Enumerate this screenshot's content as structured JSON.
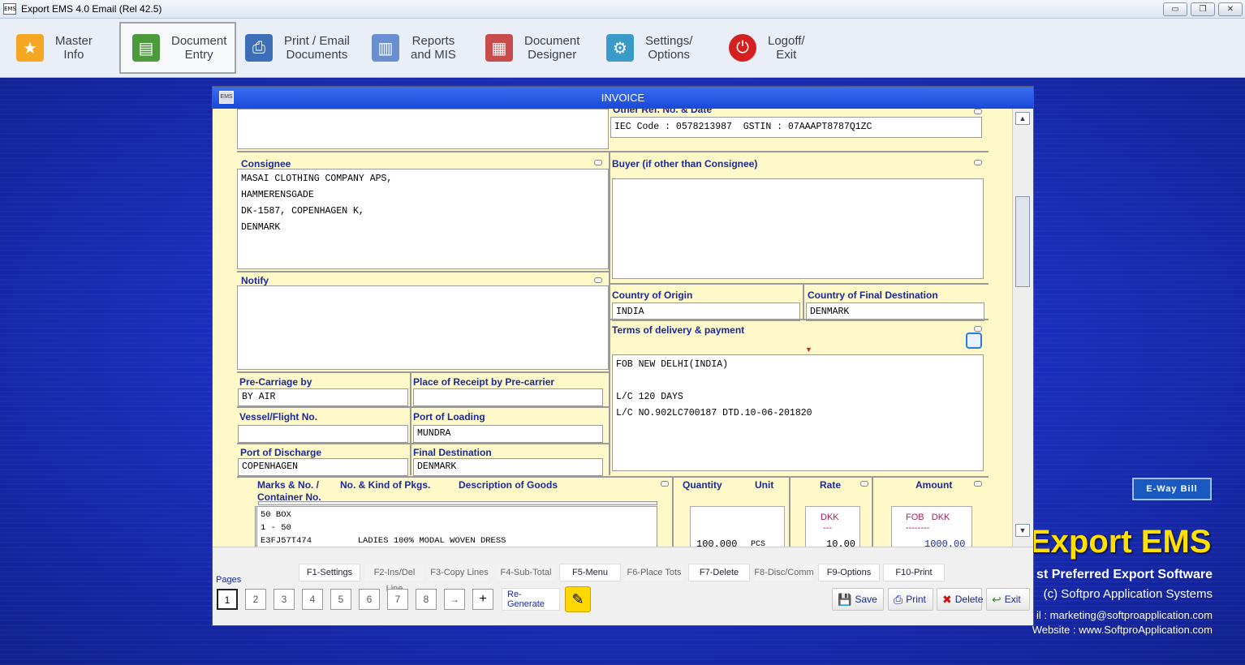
{
  "window": {
    "title": "Export EMS 4.0 Email (Rel 42.5)",
    "app_icon": "EMS"
  },
  "window_controls": {
    "minimize": "▭",
    "restore": "❐",
    "close": "✕"
  },
  "toolbar": [
    {
      "id": "master",
      "label1": "Master",
      "label2": "Info",
      "icon": "star-icon",
      "glyph": "★"
    },
    {
      "id": "document",
      "label1": "Document",
      "label2": "Entry",
      "icon": "document-entry-icon",
      "glyph": "▤"
    },
    {
      "id": "print",
      "label1": "Print / Email",
      "label2": "Documents",
      "icon": "printer-icon",
      "glyph": "⎙"
    },
    {
      "id": "reports",
      "label1": "Reports",
      "label2": "and MIS",
      "icon": "chart-icon",
      "glyph": "▥"
    },
    {
      "id": "designer",
      "label1": "Document",
      "label2": "Designer",
      "icon": "designer-icon",
      "glyph": "▦"
    },
    {
      "id": "settings",
      "label1": "Settings/",
      "label2": "Options",
      "icon": "gears-icon",
      "glyph": "⚙"
    },
    {
      "id": "logoff",
      "label1": "Logoff/",
      "label2": "Exit",
      "icon": "power-icon",
      "glyph": "⏻"
    }
  ],
  "dialog": {
    "title": "INVOICE",
    "icon": "EMS"
  },
  "form": {
    "other_ref": {
      "label": "Other Ref. No. & Date",
      "value": "IEC Code : 0578213987  GSTIN : 07AAAPT8787Q1ZC"
    },
    "consignee": {
      "label": "Consignee",
      "value": "MASAI CLOTHING COMPANY APS,\nHAMMERENSGADE\nDK-1587, COPENHAGEN K,\nDENMARK"
    },
    "buyer": {
      "label": "Buyer (if other than Consignee)",
      "value": ""
    },
    "notify": {
      "label": "Notify",
      "value": ""
    },
    "country_origin": {
      "label": "Country of Origin",
      "value": "INDIA"
    },
    "country_dest": {
      "label": "Country of Final Destination",
      "value": "DENMARK"
    },
    "terms": {
      "label": "Terms of delivery & payment",
      "value": "FOB NEW DELHI(INDIA)\n\nL/C 120 DAYS\nL/C NO.902LC700187 DTD.10-06-201820"
    },
    "pre_carriage": {
      "label": "Pre-Carriage by",
      "value": "BY AIR"
    },
    "place_receipt": {
      "label": "Place of Receipt by Pre-carrier",
      "value": ""
    },
    "vessel": {
      "label": "Vessel/Flight No.",
      "value": ""
    },
    "port_loading": {
      "label": "Port of Loading",
      "value": "MUNDRA"
    },
    "port_discharge": {
      "label": "Port of Discharge",
      "value": "COPENHAGEN"
    },
    "final_dest": {
      "label": "Final Destination",
      "value": "DENMARK"
    },
    "goods": {
      "marks_label": "Marks & No. /",
      "container_label": "Container No.",
      "pkgs_label": "No. & Kind of Pkgs.",
      "desc_label": "Description of Goods",
      "qty_label": "Quantity",
      "unit_label": "Unit",
      "rate_label": "Rate",
      "amount_label": "Amount",
      "desc_value": "50 BOX\n1 - 50\nE3FJ57T474         LADIES 100% MODAL WOVEN DRESS",
      "qty_value": "100.000",
      "unit_value": "PCS",
      "rate_currency": "DKK",
      "rate_sep": "---",
      "rate_value": "10.00",
      "amount_currency": "FOB   DKK",
      "amount_sep": "--------",
      "amount_value": "1000.00"
    }
  },
  "fkeys": [
    {
      "label": "F1-Settings",
      "active": true
    },
    {
      "label": "F2-Ins/Del Line",
      "active": false
    },
    {
      "label": "F3-Copy Lines",
      "active": false
    },
    {
      "label": "F4-Sub-Total",
      "active": false
    },
    {
      "label": "F5-Menu",
      "active": true
    },
    {
      "label": "F6-Place Tots",
      "active": false
    },
    {
      "label": "F7-Delete",
      "active": true
    },
    {
      "label": "F8-Disc/Comm",
      "active": false
    },
    {
      "label": "F9-Options",
      "active": true
    },
    {
      "label": "F10-Print",
      "active": true
    }
  ],
  "pages": {
    "label": "Pages",
    "items": [
      "1",
      "2",
      "3",
      "4",
      "5",
      "6",
      "7",
      "8"
    ],
    "next": "→",
    "add": "+",
    "current": "1",
    "regenerate": "Re-Generate"
  },
  "actions": {
    "save": "Save",
    "print": "Print",
    "delete": "Delete",
    "exit": "Exit"
  },
  "brand": {
    "name": "Export EMS",
    "tagline": "st Preferred Export Software",
    "copyright": "(c) Softpro Application Systems",
    "email": "il : marketing@softproapplication.com",
    "website": "Website : www.SoftproApplication.com"
  },
  "eway_bill": "E-Way Bill",
  "colors": {
    "label_blue": "#1a2a9a",
    "form_bg": "#fff8c8",
    "title_blue": "#1848d8",
    "brand_yellow": "#ffe000"
  }
}
